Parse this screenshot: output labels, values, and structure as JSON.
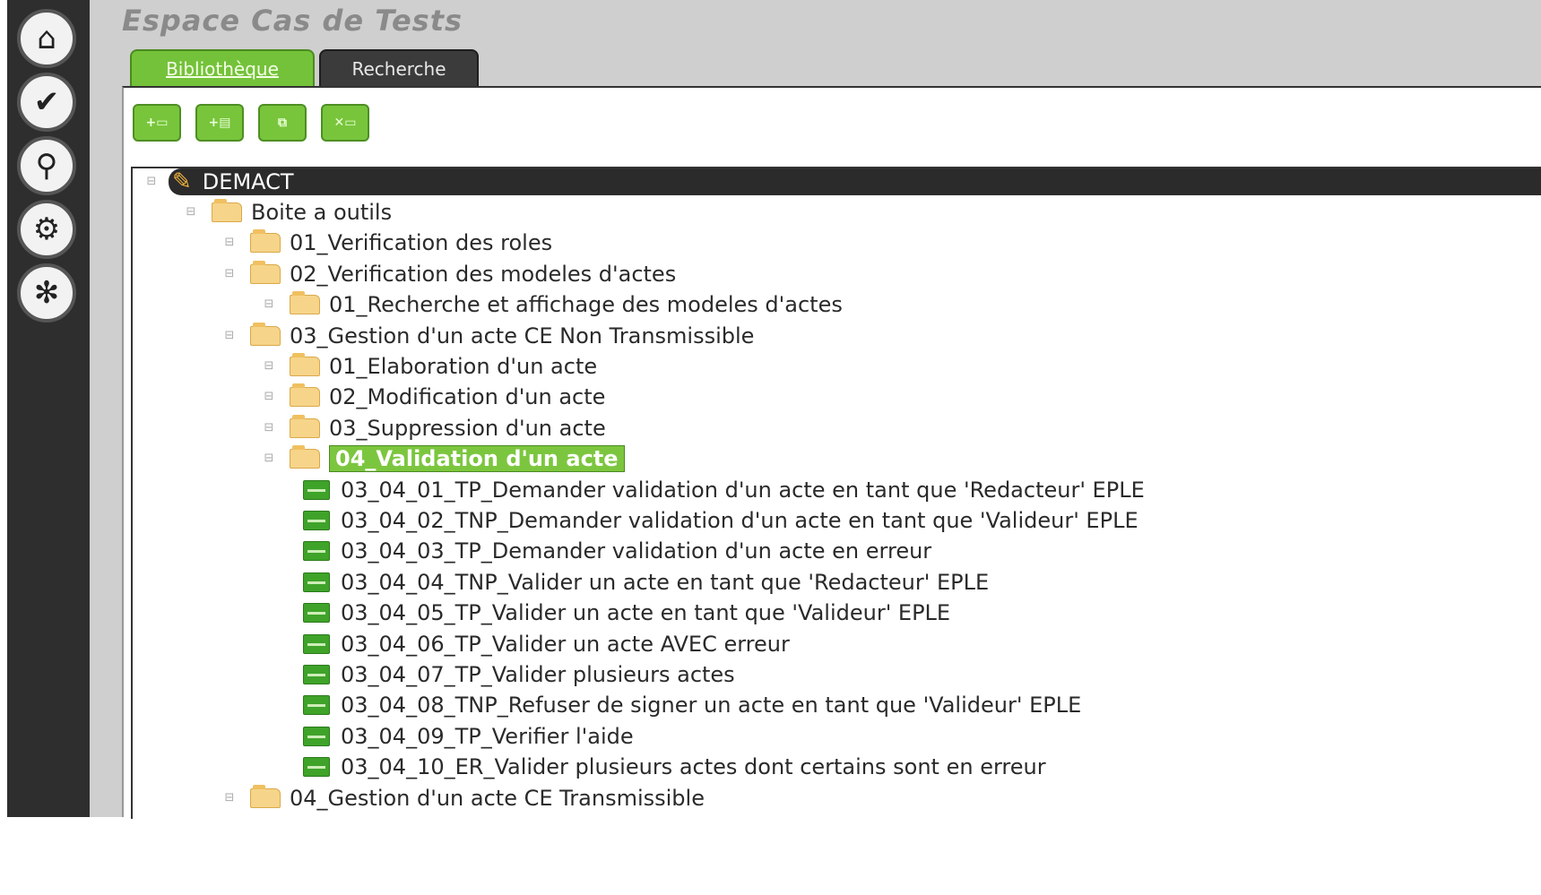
{
  "sidebar": {
    "buttons": [
      {
        "icon": "home-icon",
        "glyph": "⌂"
      },
      {
        "icon": "check-icon",
        "glyph": "✔"
      },
      {
        "icon": "pin-icon",
        "glyph": "⚲"
      },
      {
        "icon": "gears-icon",
        "glyph": "⚙"
      },
      {
        "icon": "bug-icon",
        "glyph": "✻"
      }
    ]
  },
  "header": {
    "title": "Espace Cas de Tests"
  },
  "tabs": [
    {
      "label": "Bibliothèque",
      "active": true
    },
    {
      "label": "Recherche",
      "active": false
    }
  ],
  "toolbar": {
    "buttons": [
      {
        "icon": "add-folder-icon",
        "glyph": "+▭"
      },
      {
        "icon": "add-test-icon",
        "glyph": "+▤"
      },
      {
        "icon": "copy-icon",
        "glyph": "⧉"
      },
      {
        "icon": "delete-icon",
        "glyph": "✕▭"
      }
    ]
  },
  "colors": {
    "accent_green": "#74c23a",
    "sidebar_dark": "#2e2e2e",
    "folder_yellow": "#f6d48a",
    "testcase_green": "#3fa32a"
  },
  "tree": {
    "root": "DEMACT",
    "nodes": [
      {
        "label": "Boite a outils",
        "type": "folder",
        "level": 1
      },
      {
        "label": "01_Verification des roles",
        "type": "folder",
        "level": 2
      },
      {
        "label": "02_Verification des modeles d'actes",
        "type": "folder",
        "level": 2
      },
      {
        "label": "01_Recherche et affichage des modeles d'actes",
        "type": "folder",
        "level": 3
      },
      {
        "label": "03_Gestion d'un acte CE Non Transmissible",
        "type": "folder",
        "level": 2
      },
      {
        "label": "01_Elaboration d'un acte",
        "type": "folder",
        "level": 3
      },
      {
        "label": "02_Modification d'un acte",
        "type": "folder",
        "level": 3
      },
      {
        "label": "03_Suppression d'un acte",
        "type": "folder",
        "level": 3
      },
      {
        "label": "04_Validation d'un acte",
        "type": "folder",
        "level": 3,
        "selected": true
      },
      {
        "label": "03_04_01_TP_Demander validation d'un acte en tant que 'Redacteur' EPLE",
        "type": "test",
        "level": 4
      },
      {
        "label": "03_04_02_TNP_Demander validation d'un acte en tant que 'Valideur' EPLE",
        "type": "test",
        "level": 4
      },
      {
        "label": "03_04_03_TP_Demander validation d'un acte en erreur",
        "type": "test",
        "level": 4
      },
      {
        "label": "03_04_04_TNP_Valider un acte en tant que 'Redacteur' EPLE",
        "type": "test",
        "level": 4
      },
      {
        "label": "03_04_05_TP_Valider un acte en tant que 'Valideur' EPLE",
        "type": "test",
        "level": 4
      },
      {
        "label": "03_04_06_TP_Valider un acte AVEC erreur",
        "type": "test",
        "level": 4
      },
      {
        "label": "03_04_07_TP_Valider plusieurs actes",
        "type": "test",
        "level": 4
      },
      {
        "label": "03_04_08_TNP_Refuser de signer un acte en tant que 'Valideur' EPLE",
        "type": "test",
        "level": 4
      },
      {
        "label": "03_04_09_TP_Verifier l'aide",
        "type": "test",
        "level": 4
      },
      {
        "label": "03_04_10_ER_Valider plusieurs actes dont certains sont en erreur",
        "type": "test",
        "level": 4
      },
      {
        "label": "04_Gestion d'un acte CE Transmissible",
        "type": "folder",
        "level": 2
      }
    ]
  }
}
